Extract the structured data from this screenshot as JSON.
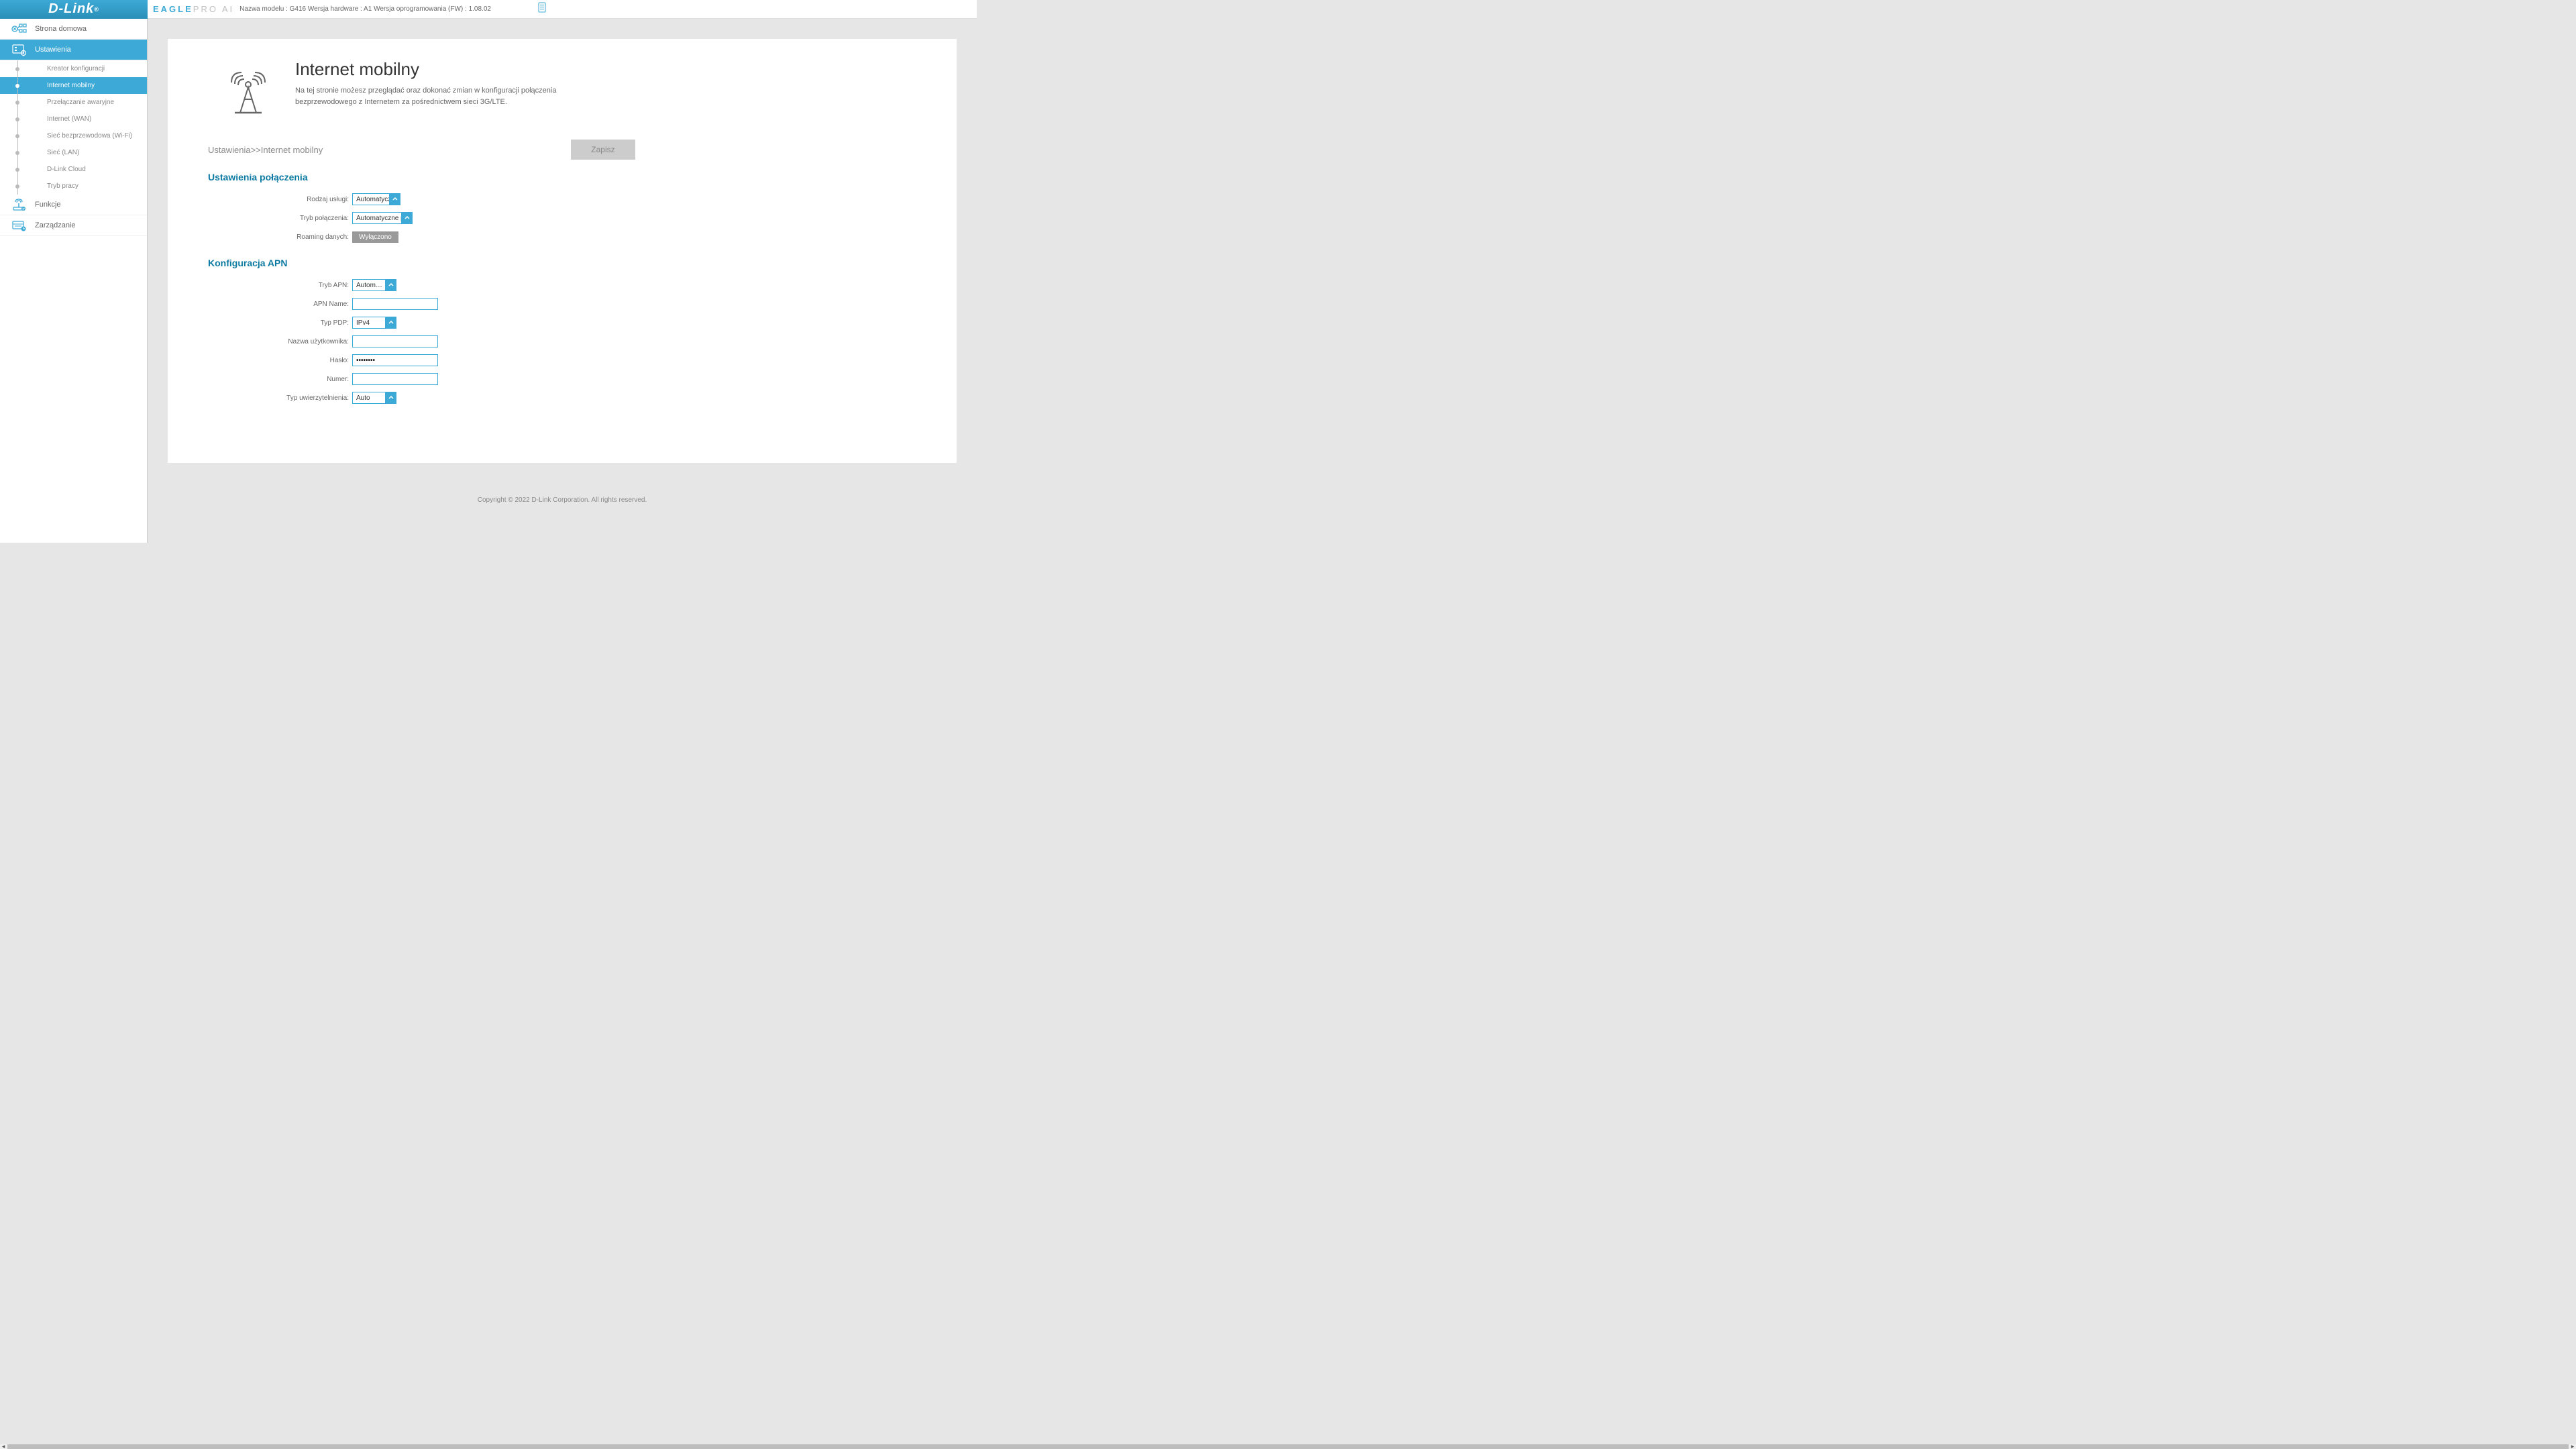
{
  "header": {
    "logo_text": "D-Link",
    "eagle_text": "EAGLE",
    "pro_text": "PRO AI",
    "model_info": "Nazwa modelu : G416 Wersja hardware : A1 Wersja oprogramowania (FW) : 1.08.02"
  },
  "sidebar": {
    "home": "Strona domowa",
    "settings": "Ustawienia",
    "sub": {
      "wizard": "Kreator konfiguracji",
      "mobile": "Internet mobilny",
      "failover": "Przełączanie awaryjne",
      "wan": "Internet (WAN)",
      "wifi": "Sieć bezprzewodowa (Wi-Fi)",
      "lan": "Sieć (LAN)",
      "cloud": "D-Link Cloud",
      "mode": "Tryb pracy"
    },
    "functions": "Funkcje",
    "management": "Zarządzanie"
  },
  "page": {
    "title": "Internet mobilny",
    "description": "Na tej stronie możesz przeglądać oraz dokonać zmian w konfiguracji połączenia bezprzewodowego z Internetem za pośrednictwem sieci 3G/LTE.",
    "breadcrumb": "Ustawienia>>Internet mobilny",
    "save_btn": "Zapisz"
  },
  "connection": {
    "section_title": "Ustawienia połączenia",
    "service_type_label": "Rodzaj usługi:",
    "service_type_value": "Automatyczny",
    "conn_mode_label": "Tryb połączenia:",
    "conn_mode_value": "Automatyczne p…",
    "roaming_label": "Roaming danych:",
    "roaming_value": "Wyłączono"
  },
  "apn": {
    "section_title": "Konfiguracja APN",
    "apn_mode_label": "Tryb APN:",
    "apn_mode_value": "Autom…",
    "apn_name_label": "APN Name:",
    "apn_name_value": "",
    "pdp_type_label": "Typ PDP:",
    "pdp_type_value": "IPv4",
    "username_label": "Nazwa użytkownika:",
    "username_value": "",
    "password_label": "Hasło:",
    "password_value": "••••••••",
    "number_label": "Numer:",
    "number_value": "",
    "auth_type_label": "Typ uwierzytelnienia:",
    "auth_type_value": "Auto"
  },
  "footer": {
    "copyright": "Copyright © 2022 D-Link Corporation. All rights reserved."
  }
}
